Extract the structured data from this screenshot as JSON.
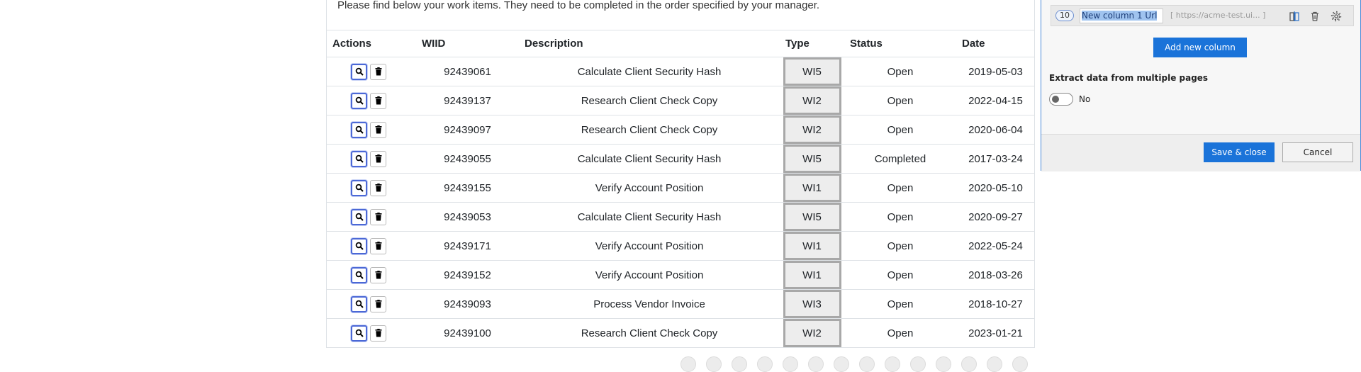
{
  "intro_text": "Please find below your work items. They need to be completed in the order specified by your manager.",
  "table": {
    "headers": [
      "Actions",
      "WIID",
      "Description",
      "Type",
      "Status",
      "Date"
    ],
    "rows": [
      {
        "wiid": "92439061",
        "description": "Calculate Client Security Hash",
        "type": "WI5",
        "status": "Open",
        "date": "2019-05-03"
      },
      {
        "wiid": "92439137",
        "description": "Research Client Check Copy",
        "type": "WI2",
        "status": "Open",
        "date": "2022-04-15"
      },
      {
        "wiid": "92439097",
        "description": "Research Client Check Copy",
        "type": "WI2",
        "status": "Open",
        "date": "2020-06-04"
      },
      {
        "wiid": "92439055",
        "description": "Calculate Client Security Hash",
        "type": "WI5",
        "status": "Completed",
        "date": "2017-03-24"
      },
      {
        "wiid": "92439155",
        "description": "Verify Account Position",
        "type": "WI1",
        "status": "Open",
        "date": "2020-05-10"
      },
      {
        "wiid": "92439053",
        "description": "Calculate Client Security Hash",
        "type": "WI5",
        "status": "Open",
        "date": "2020-09-27"
      },
      {
        "wiid": "92439171",
        "description": "Verify Account Position",
        "type": "WI1",
        "status": "Open",
        "date": "2022-05-24"
      },
      {
        "wiid": "92439152",
        "description": "Verify Account Position",
        "type": "WI1",
        "status": "Open",
        "date": "2018-03-26"
      },
      {
        "wiid": "92439093",
        "description": "Process Vendor Invoice",
        "type": "WI3",
        "status": "Open",
        "date": "2018-10-27"
      },
      {
        "wiid": "92439100",
        "description": "Research Client Check Copy",
        "type": "WI2",
        "status": "Open",
        "date": "2023-01-21"
      }
    ]
  },
  "panel": {
    "column": {
      "number": "10",
      "name": "New column 1 Url",
      "url": "[ https://acme-test.ui... ]"
    },
    "add_new_column": "Add new column",
    "extract_label": "Extract data from multiple pages",
    "toggle_label": "No",
    "toggle_state": "off",
    "save_close": "Save & close",
    "cancel": "Cancel"
  },
  "colors": {
    "accent": "#1a73d9",
    "view_button_border": "#4b68d6",
    "panel_border": "#4a8ad8"
  }
}
